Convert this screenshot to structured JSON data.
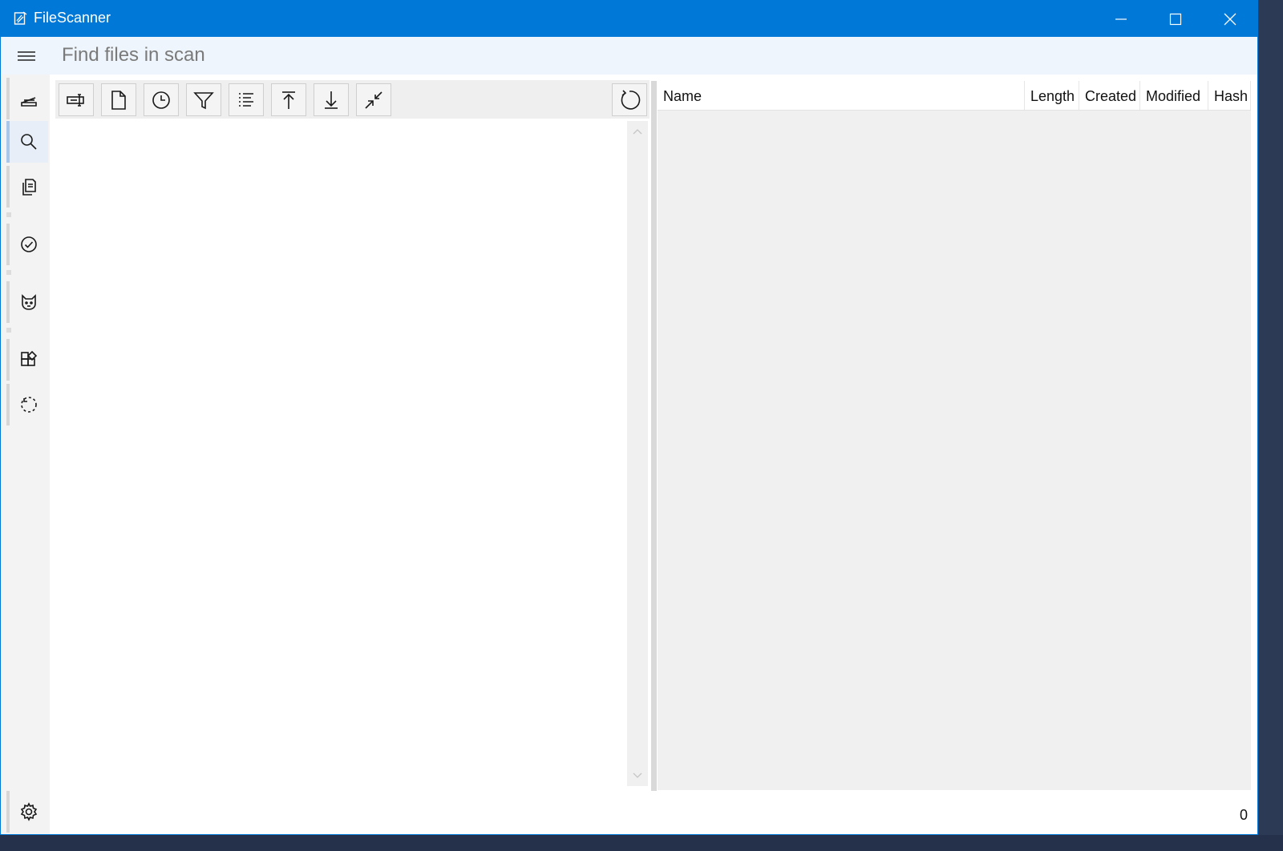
{
  "window": {
    "title": "FileScanner",
    "accent_color": "#0078d7",
    "controls": [
      "minimize-icon",
      "maximize-icon",
      "close-icon"
    ]
  },
  "search": {
    "placeholder": "Find files in scan",
    "value": ""
  },
  "nav": {
    "items": [
      {
        "icon": "scanner-icon",
        "active": false
      },
      {
        "icon": "search-icon",
        "active": true
      },
      {
        "icon": "copy-icon",
        "active": false
      },
      {
        "icon": "checkmark-icon",
        "active": false
      },
      {
        "icon": "cat-icon",
        "active": false
      },
      {
        "icon": "apps-icon",
        "active": false
      },
      {
        "icon": "progress-ring-icon",
        "active": false
      }
    ],
    "footer_icon": "settings-icon"
  },
  "toolbar": {
    "buttons": [
      "rename-icon",
      "document-icon",
      "clock-icon",
      "filter-icon",
      "list-icon",
      "arrow-up-icon",
      "arrow-down-icon",
      "collapse-icon"
    ],
    "refresh_icon": "refresh-icon"
  },
  "results": {
    "columns": [
      "Name",
      "Length",
      "Created",
      "Modified",
      "Hash"
    ],
    "rows": []
  },
  "status": {
    "count": "0"
  }
}
